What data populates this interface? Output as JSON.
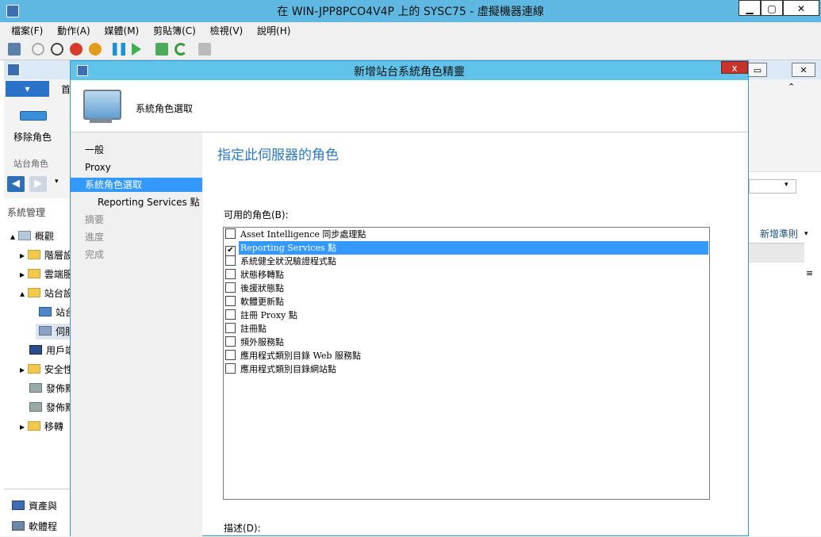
{
  "vm_window": {
    "title": "在 WIN-JPP8PCO4V4P 上的 SYSC75 - 虛擬機器連線",
    "minimize": "▁",
    "maximize": "▢",
    "close": "✕"
  },
  "menu": [
    "檔案(F)",
    "動作(A)",
    "媒體(M)",
    "剪貼簿(C)",
    "檢視(V)",
    "說明(H)"
  ],
  "console": {
    "tab_label": "首",
    "ribbon_button": "移除角色",
    "ribbon_group": "站台角色",
    "tree_root": "系統管理",
    "tree": [
      "概觀",
      "階層設",
      "雲端服",
      "站台設",
      "站台",
      "伺服",
      "用戶端",
      "安全性",
      "發佈點",
      "發佈點",
      "移轉"
    ],
    "bottom_nav": [
      "資產與",
      "軟體程"
    ],
    "right_action": "新增準則",
    "win_buttons": [
      "▭",
      "✕"
    ]
  },
  "wizard": {
    "title": "新增站台系統角色精靈",
    "close": "x",
    "header_title": "系統角色選取",
    "steps": [
      {
        "label": "一般"
      },
      {
        "label": "Proxy"
      },
      {
        "label": "系統角色選取"
      },
      {
        "label": "Reporting Services 點"
      },
      {
        "label": "摘要"
      },
      {
        "label": "進度"
      },
      {
        "label": "完成"
      }
    ],
    "heading": "指定此伺服器的角色",
    "available_roles_label": "可用的角色(B):",
    "roles": [
      {
        "label": "Asset Intelligence 同步處理點",
        "checked": false
      },
      {
        "label": "Reporting Services 點",
        "checked": true
      },
      {
        "label": "系統健全狀況驗證程式點",
        "checked": false
      },
      {
        "label": "狀態移轉點",
        "checked": false
      },
      {
        "label": "後援狀態點",
        "checked": false
      },
      {
        "label": "軟體更新點",
        "checked": false
      },
      {
        "label": "註冊 Proxy 點",
        "checked": false
      },
      {
        "label": "註冊點",
        "checked": false
      },
      {
        "label": "頻外服務點",
        "checked": false
      },
      {
        "label": "應用程式類別目錄 Web 服務點",
        "checked": false
      },
      {
        "label": "應用程式類別目錄網站點",
        "checked": false
      }
    ],
    "check_mark": "✔",
    "description_label": "描述(D):"
  }
}
